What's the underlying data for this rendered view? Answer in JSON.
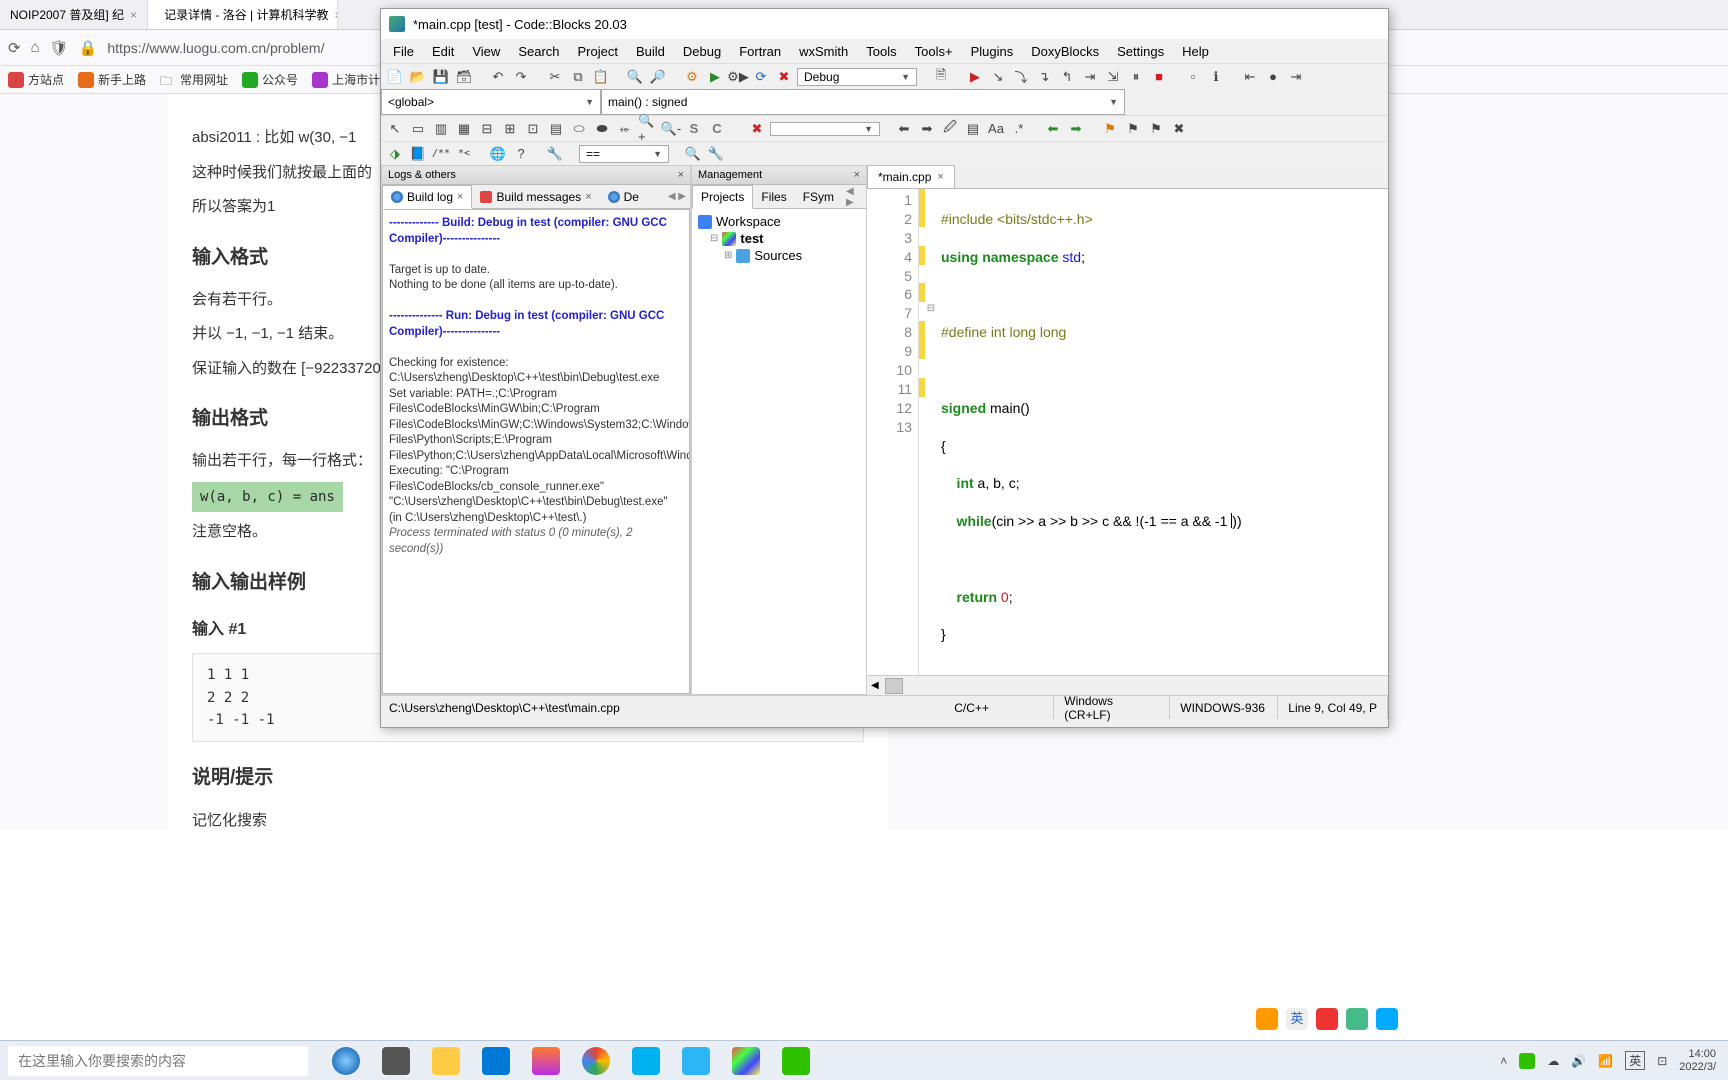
{
  "browser": {
    "tabs": [
      {
        "title": "NOIP2007 普及组] 纪"
      },
      {
        "title": "记录详情 - 洛谷 | 计算机科学教"
      }
    ],
    "url": "https://www.luogu.com.cn/problem/",
    "bookmarks": [
      "方站点",
      "新手上路",
      "常用网址",
      "公众号",
      "上海市计算机学"
    ]
  },
  "page": {
    "note_line": "absi2011 : 比如 w(30, −1",
    "note_line2": "这种时候我们就按最上面的",
    "note_line3": "所以答案为1",
    "h_input": "输入格式",
    "p_input1": "会有若干行。",
    "p_input2": "并以 −1, −1, −1 结束。",
    "p_input3": "保证输入的数在 [−92233720",
    "h_output": "输出格式",
    "p_output1": "输出若干行，每一行格式：",
    "code_fmt": "w(a, b, c) = ans",
    "p_output2": "注意空格。",
    "h_sample": "输入输出样例",
    "h_sample_in": "输入 #1",
    "sample_in": "1 1 1\n2 2 2\n-1 -1 -1",
    "h_hint": "说明/提示",
    "p_hint": "记忆化搜索"
  },
  "ide": {
    "title": "*main.cpp [test] - Code::Blocks 20.03",
    "menu": [
      "File",
      "Edit",
      "View",
      "Search",
      "Project",
      "Build",
      "Debug",
      "Fortran",
      "wxSmith",
      "Tools",
      "Tools+",
      "Plugins",
      "DoxyBlocks",
      "Settings",
      "Help"
    ],
    "build_target": "Debug",
    "scope_global": "<global>",
    "scope_main": "main() : signed",
    "compare_op": "==",
    "management": {
      "title": "Management",
      "tabs": [
        "Projects",
        "Files",
        "FSym"
      ],
      "tree": {
        "root": "Workspace",
        "project": "test",
        "folder": "Sources"
      }
    },
    "logs": {
      "title": "Logs & others",
      "tabs": [
        "Build log",
        "Build messages",
        "De"
      ],
      "body_header": "------------- Build: Debug in test (compiler: GNU GCC Compiler)---------------",
      "body_l1": "Target is up to date.",
      "body_l2": "Nothing to be done (all items are up-to-date).",
      "body_run": "-------------- Run: Debug in test (compiler: GNU GCC Compiler)---------------",
      "body_check": "Checking for existence: C:\\Users\\zheng\\Desktop\\C++\\test\\bin\\Debug\\test.exe",
      "body_path": "Set variable: PATH=.;C:\\Program Files\\CodeBlocks\\MinGW\\bin;C:\\Program Files\\CodeBlocks\\MinGW;C:\\Windows\\System32;C:\\Windows;C:\\Windows\\System32\\wbem;C:\\Windows\\System32\\WindowsPowerShell\\v1.0;C:\\Windows\\System32\\OpenSSH;E:\\Program Files\\Python\\Scripts;E:\\Program Files\\Python;C:\\Users\\zheng\\AppData\\Local\\Microsoft\\WindowsApps",
      "body_exec": "Executing: \"C:\\Program Files\\CodeBlocks/cb_console_runner.exe\" \"C:\\Users\\zheng\\Desktop\\C++\\test\\bin\\Debug\\test.exe\"  (in C:\\Users\\zheng\\Desktop\\C++\\test\\.)",
      "body_term": "Process terminated with status 0 (0 minute(s), 2 second(s))"
    },
    "editor": {
      "tab": "*main.cpp",
      "lines": {
        "l1": "#include <bits/stdc++.h>",
        "l2_a": "using namespace ",
        "l2_b": "std",
        "l2_c": ";",
        "l3": "",
        "l4": "#define int long long",
        "l5": "",
        "l6_a": "signed ",
        "l6_b": "main",
        "l6_c": "()",
        "l7": "{",
        "l8_a": "    int",
        "l8_b": " a, b, c;",
        "l9_a": "    while",
        "l9_b": "(cin >> a >> b >> c && !(-1 == a && -1 ",
        "l9_c": "))",
        "l10": "",
        "l11_a": "    return ",
        "l11_b": "0",
        "l11_c": ";",
        "l12": "}",
        "l13": ""
      },
      "line_count": 13
    },
    "status": {
      "path": "C:\\Users\\zheng\\Desktop\\C++\\test\\main.cpp",
      "lang": "C/C++",
      "eol": "Windows (CR+LF)",
      "enc": "WINDOWS-936",
      "pos": "Line 9, Col 49, P"
    }
  },
  "taskbar": {
    "search_placeholder": "在这里输入你要搜索的内容",
    "time": "14:00",
    "date": "2022/3/"
  },
  "tray_ime": "英"
}
